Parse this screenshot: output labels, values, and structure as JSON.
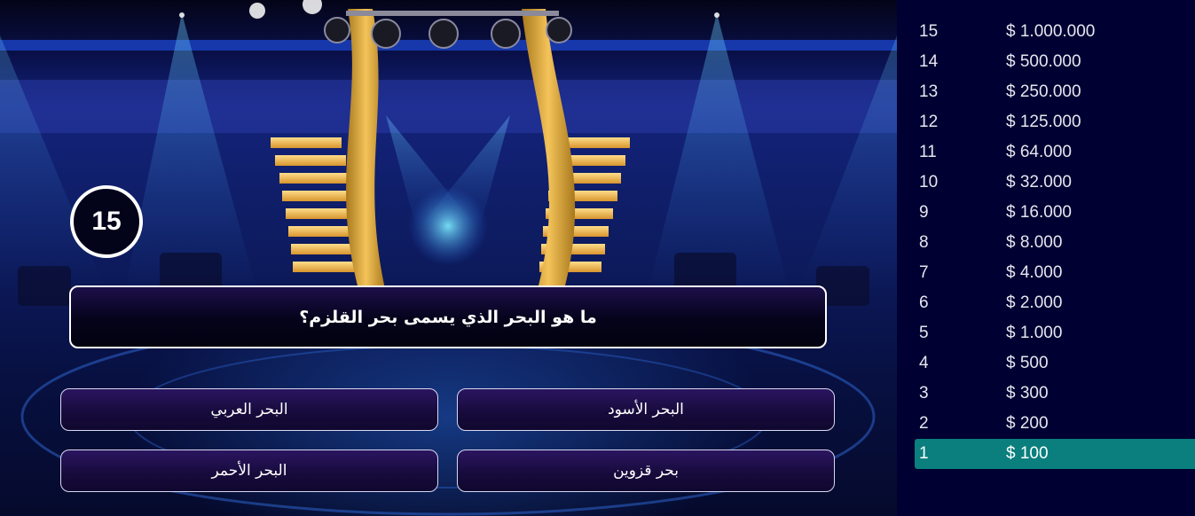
{
  "timer": {
    "seconds": "15"
  },
  "question": {
    "text": "ما هو البحر الذي يسمى بحر القلزم؟"
  },
  "answers": [
    {
      "text": "البحر العربي"
    },
    {
      "text": "البحر الأسود"
    },
    {
      "text": "البحر الأحمر"
    },
    {
      "text": "بحر قزوين"
    }
  ],
  "prize_ladder": [
    {
      "level": "15",
      "amount": "$ 1.000.000"
    },
    {
      "level": "14",
      "amount": "$ 500.000"
    },
    {
      "level": "13",
      "amount": "$ 250.000"
    },
    {
      "level": "12",
      "amount": "$ 125.000"
    },
    {
      "level": "11",
      "amount": "$ 64.000"
    },
    {
      "level": "10",
      "amount": "$ 32.000"
    },
    {
      "level": "9",
      "amount": "$ 16.000"
    },
    {
      "level": "8",
      "amount": "$ 8.000"
    },
    {
      "level": "7",
      "amount": "$ 4.000"
    },
    {
      "level": "6",
      "amount": "$ 2.000"
    },
    {
      "level": "5",
      "amount": "$ 1.000"
    },
    {
      "level": "4",
      "amount": "$ 500"
    },
    {
      "level": "3",
      "amount": "$ 300"
    },
    {
      "level": "2",
      "amount": "$ 200"
    },
    {
      "level": "1",
      "amount": "$ 100"
    }
  ],
  "current_level": "1",
  "colors": {
    "ladder_background": "#000032",
    "highlight": "#0a7f7d",
    "panel_border": "#ffffff"
  }
}
